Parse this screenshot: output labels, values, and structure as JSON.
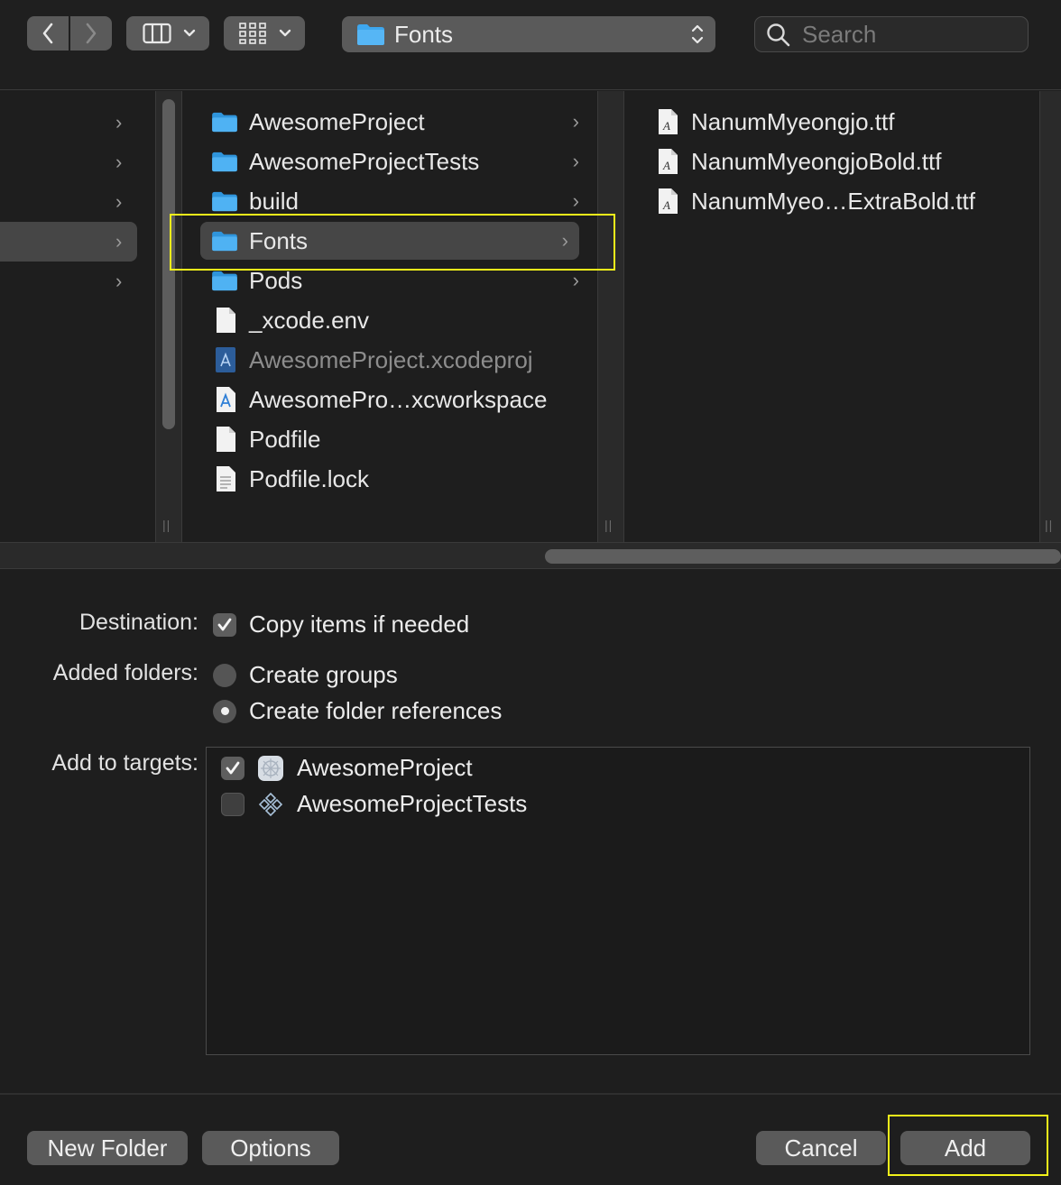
{
  "toolbar": {
    "path_folder": "Fonts",
    "search_placeholder": "Search"
  },
  "columns": {
    "middle": [
      {
        "label": "AwesomeProject",
        "icon": "folder-icon",
        "has_children": true
      },
      {
        "label": "AwesomeProjectTests",
        "icon": "folder-icon",
        "has_children": true
      },
      {
        "label": "build",
        "icon": "folder-icon",
        "has_children": true
      },
      {
        "label": "Fonts",
        "icon": "folder-icon",
        "has_children": true,
        "selected": true
      },
      {
        "label": "Pods",
        "icon": "folder-icon",
        "has_children": true
      },
      {
        "label": "_xcode.env",
        "icon": "document-icon"
      },
      {
        "label": "AwesomeProject.xcodeproj",
        "icon": "xcode-project-icon",
        "dimmed": true
      },
      {
        "label": "AwesomePro…xcworkspace",
        "icon": "xcode-workspace-icon"
      },
      {
        "label": "Podfile",
        "icon": "document-icon"
      },
      {
        "label": "Podfile.lock",
        "icon": "text-document-icon"
      }
    ],
    "right": [
      {
        "label": "NanumMyeongjo.ttf",
        "icon": "font-file-icon"
      },
      {
        "label": "NanumMyeongjoBold.ttf",
        "icon": "font-file-icon"
      },
      {
        "label": "NanumMyeo…ExtraBold.ttf",
        "icon": "font-file-icon"
      }
    ]
  },
  "options": {
    "destination_label": "Destination:",
    "copy_items_label": "Copy items if needed",
    "copy_items_checked": true,
    "added_folders_label": "Added folders:",
    "create_groups_label": "Create groups",
    "create_folder_refs_label": "Create folder references",
    "selected_folder_option": "Create folder references",
    "add_to_targets_label": "Add to targets:",
    "targets": [
      {
        "label": "AwesomeProject",
        "checked": true,
        "icon": "app-target-icon"
      },
      {
        "label": "AwesomeProjectTests",
        "checked": false,
        "icon": "test-target-icon"
      }
    ]
  },
  "buttons": {
    "new_folder": "New Folder",
    "options": "Options",
    "cancel": "Cancel",
    "add": "Add"
  },
  "colors": {
    "highlight": "#f2f21a",
    "folder_blue": "#3ea7ef",
    "background": "#1e1e1e"
  }
}
